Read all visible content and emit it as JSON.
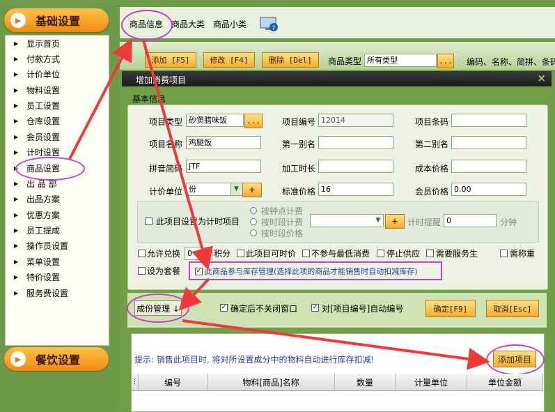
{
  "sidebar": {
    "top_section": "基础设置",
    "bottom_section": "餐饮设置",
    "items": [
      "显示首页",
      "付款方式",
      "计价单位",
      "物料设置",
      "员工设置",
      "仓库设置",
      "会员设置",
      "计时设置",
      "商品设置",
      "出 品 部",
      "出品方案",
      "优惠方案",
      "员工提成",
      "操作员设置",
      "菜单设置",
      "特价设置",
      "服务费设置"
    ]
  },
  "tabs": [
    "商品信息",
    "商品大类",
    "商品小类"
  ],
  "toolbar": {
    "add": "添加 [F5]",
    "edit": "修改 [F4]",
    "delete": "删除 [Del]",
    "type_label": "商品类型",
    "type_value": "所有类型",
    "more": "...",
    "search_hint": "编码、名称、简拼、条码"
  },
  "dialog": {
    "title": "增加消费项目",
    "close": "×",
    "group_title": "基本信息",
    "fields": {
      "item_type_label": "项目类型",
      "item_type_value": "砂煲腊味饭",
      "item_no_label": "项目编号",
      "item_no_value": "12014",
      "barcode_label": "项目条码",
      "barcode_value": "",
      "name_label": "项目名称",
      "name_value": "鸡腿饭",
      "alias1_label": "第一别名",
      "alias1_value": "",
      "alias2_label": "第二别名",
      "alias2_value": "",
      "pinyin_label": "拼音简码",
      "pinyin_value": "JTF",
      "process_label": "加工时长",
      "process_value": "",
      "cost_label": "成本价格",
      "cost_value": "",
      "unit_label": "计价单位",
      "unit_value": "份",
      "std_price_label": "标准价格",
      "std_price_value": "16",
      "member_price_label": "会员价格",
      "member_price_value": "0.00"
    },
    "timing": {
      "checkbox": "此项目设置为计时项目",
      "radio1": "按钟点计费",
      "radio2": "按时段计费",
      "radio3": "按时段价格",
      "remind_label": "计时提醒",
      "remind_value": "0",
      "remind_unit": "分钟"
    },
    "options": {
      "allow_exchange": "允许兑换",
      "exchange_value": "0",
      "points": "积分",
      "timed_price": "此项目可时价",
      "no_min": "不参与最低消费",
      "stop_supply": "停止供应",
      "need_service": "需要服务生",
      "need_weigh": "需称重",
      "set_meal": "设为套餐",
      "inventory": "此商品参与库存管理(选择此项的商品才能销售时自动扣减库存)"
    },
    "ingredient_btn": "成份管理 ↓",
    "keep_open": "确定后不关闭窗口",
    "auto_number": "对[项目编号]自动编号",
    "ok": "确定[F9]",
    "cancel": "取消[Esc]",
    "hint": "提示: 销售此项目时, 将对所设置成分中的物料自动进行库存扣减!",
    "add_item": "添加项目",
    "columns": [
      "编号",
      "物料[商品]名称",
      "数量",
      "计量单位",
      "单位金额"
    ]
  }
}
